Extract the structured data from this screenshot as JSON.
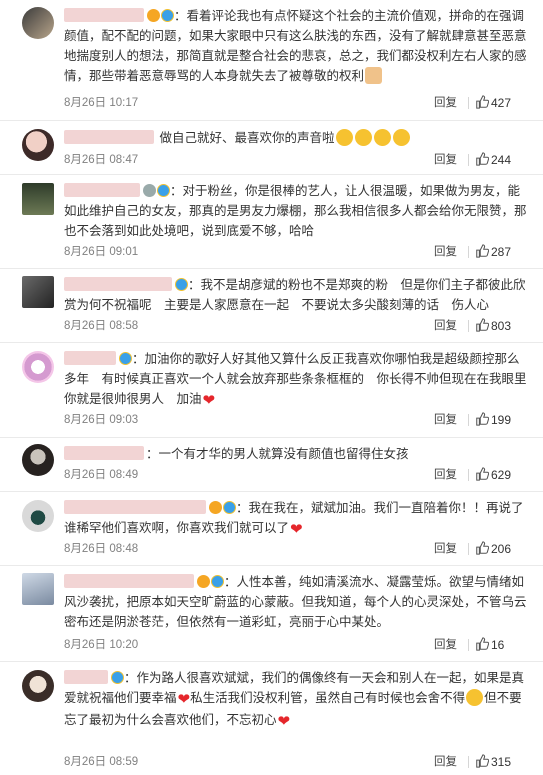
{
  "comments": [
    {
      "text": "：看着评论我也有点怀疑这个社会的主流价值观，拼命的在强调颜值，配不配的问题，如果大家眼中只有这么肤浅的东西，没有了解就肆意甚至恶意地揣度别人的想法，那简直就是整合社会的悲哀，总之，我们都没权利左右人家的感情，那些带着恶意辱骂的人本身就失去了被尊敬的权利",
      "time": "8月26日 10:17",
      "reply": "回复",
      "likes": "427",
      "emoji_tail": "thumb-emoji"
    },
    {
      "text": "做自己就好、最喜欢你的声音啦",
      "time": "8月26日 08:47",
      "reply": "回复",
      "likes": "244",
      "emoji_tail": "smile-emoji"
    },
    {
      "text": "：对于粉丝，你是很棒的艺人，让人很温暖，如果做为男友，能如此维护自己的女友，那真的是男友力爆棚，那么我相信很多人都会给你无限赞，那也不会落到如此处境吧，说到底爱不够，哈哈",
      "time": "8月26日 09:01",
      "reply": "回复",
      "likes": "287"
    },
    {
      "text": "：我不是胡彦斌的粉也不是郑爽的粉　但是你们主子都彼此欣赏为何不祝福呢　主要是人家愿意在一起　不要说太多尖酸刻薄的话　伤人心",
      "time": "8月26日 08:58",
      "reply": "回复",
      "likes": "803"
    },
    {
      "text": "：加油你的歌好人好其他又算什么反正我喜欢你哪怕我是超级颜控那么多年　有时候真正喜欢一个人就会放弃那些条条框框的　你长得不帅但现在在我眼里你就是很帅很男人　加油",
      "time": "8月26日 09:03",
      "reply": "回复",
      "likes": "199"
    },
    {
      "text": "：一个有才华的男人就算没有颜值也留得住女孩",
      "time": "8月26日 08:49",
      "reply": "回复",
      "likes": "629"
    },
    {
      "text": "：我在我在，斌斌加油。我们一直陪着你！！再说了谁稀罕他们喜欢啊，你喜欢我们就可以了",
      "time": "8月26日 08:48",
      "reply": "回复",
      "likes": "206"
    },
    {
      "text": "：人性本善，纯如清溪流水、凝露莹烁。欲望与情绪如风沙袭扰，把原本如天空旷蔚蓝的心蒙蔽。但我知道，每个人的心灵深处，不管乌云密布还是阴淤苍茫，但依然有一道彩虹，亮丽于心中某处。",
      "time": "8月26日 10:20",
      "reply": "回复",
      "likes": "16"
    },
    {
      "text_a": "：作为路人很喜欢斌斌，我们的偶像终有一天会和别人在一起，如果是真爱就祝福他们要幸福",
      "text_b": "私生活我们没权利管，虽然自己有时候也会舍不得",
      "text_c": "但不要忘了最初为什么会喜欢他们，不忘初心",
      "time": "8月26日 08:59",
      "reply": "回复",
      "likes": "315"
    }
  ],
  "colors": {
    "like_icon": "#555555",
    "heart": "#e5262b",
    "time": "#808080"
  }
}
